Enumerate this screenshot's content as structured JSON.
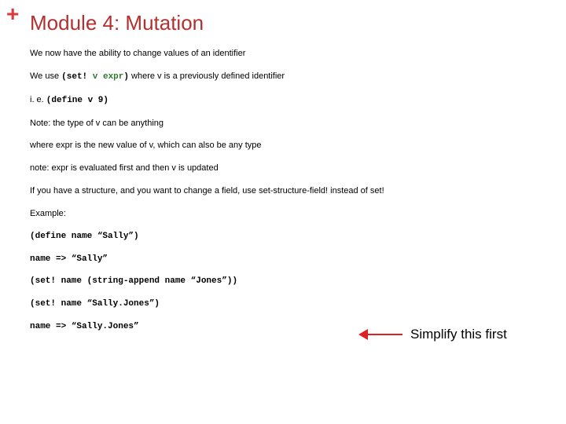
{
  "plus": "+",
  "title": "Module 4: Mutation",
  "lines": {
    "l1": "We now have the ability to change values of an identifier",
    "l2a": "We use ",
    "l2b": "(set! ",
    "l2c": "v expr",
    "l2d": ")",
    "l2e": "   where v is a previously defined identifier",
    "l3a": "i. e. ",
    "l3b": "(define v 9)",
    "l4": "Note: the type of v can be anything",
    "l5": "where expr is the new value of v, which can also be any type",
    "l6": "note: expr is evaluated first and then v is updated",
    "l7": "If you have a structure, and you want to change a field, use set-structure-field! instead of set!",
    "l8": "Example:",
    "code1": "(define name “Sally”)",
    "code2": "name => “Sally”",
    "code3": "(set! name (string-append name “Jones”))",
    "code4": "(set! name “Sally.Jones”)",
    "code5": "name => “Sally.Jones”"
  },
  "callout": "Simplify this first"
}
